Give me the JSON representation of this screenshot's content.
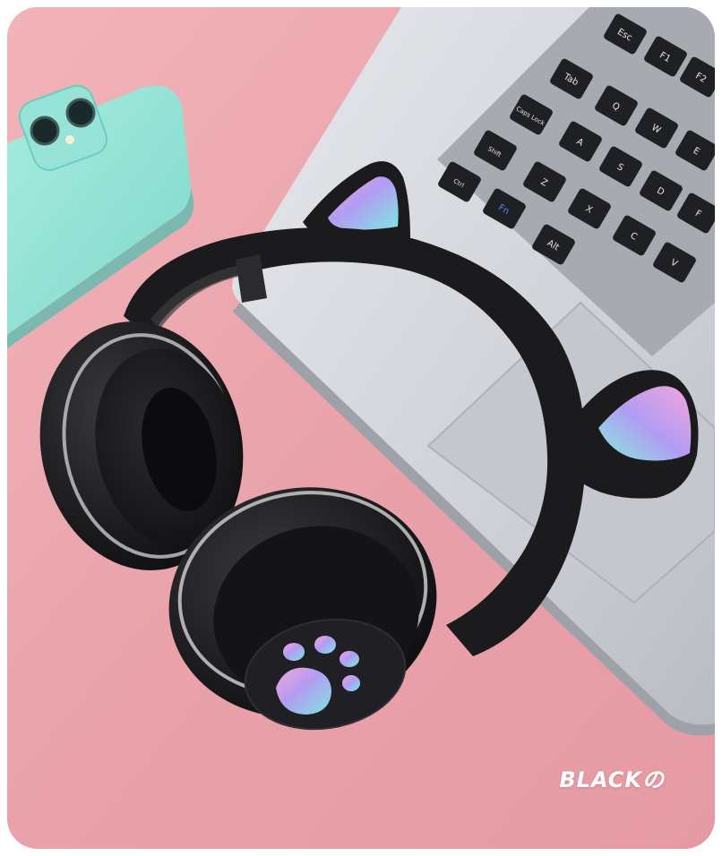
{
  "product": {
    "color_label": "BLACKの",
    "background_color": "#e9a5ab",
    "headphone_color": "#1b1b1d",
    "glow_colors": [
      "#7fe3e6",
      "#b59cf0",
      "#f0a3d9"
    ]
  },
  "laptop": {
    "keys": [
      {
        "label": "Esc"
      },
      {
        "label": "F1"
      },
      {
        "label": "F2"
      },
      {
        "label": "Tab"
      },
      {
        "label": "Q"
      },
      {
        "label": "W"
      },
      {
        "label": "E"
      },
      {
        "label": "Caps Lock"
      },
      {
        "label": "A"
      },
      {
        "label": "S"
      },
      {
        "label": "D"
      },
      {
        "label": "F"
      },
      {
        "label": "Shift"
      },
      {
        "label": "Z"
      },
      {
        "label": "X"
      },
      {
        "label": "C"
      },
      {
        "label": "V"
      },
      {
        "label": "Ctrl"
      },
      {
        "label": "Fn"
      },
      {
        "label": "Alt"
      }
    ]
  }
}
